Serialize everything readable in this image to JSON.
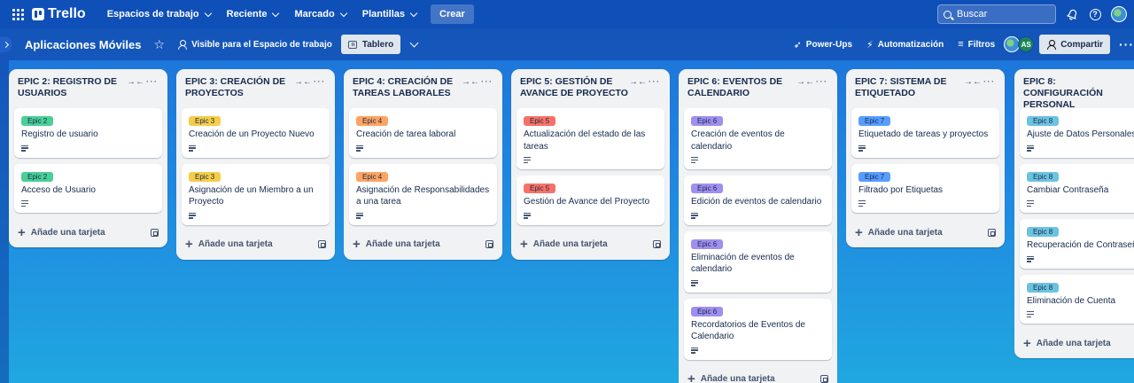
{
  "topnav": {
    "brand": "Trello",
    "items": [
      "Espacios de trabajo",
      "Reciente",
      "Marcado",
      "Plantillas"
    ],
    "create_label": "Crear",
    "search_placeholder": "Buscar"
  },
  "board": {
    "title": "Aplicaciones Móviles",
    "visibility": "Visible para el Espacio de trabajo",
    "view_label": "Tablero",
    "powerups": "Power-Ups",
    "automation": "Automatización",
    "filters": "Filtros",
    "avatar_initials": "AS",
    "share": "Compartir"
  },
  "add_card_label": "Añade una tarjeta",
  "label_colors": {
    "Epic 2": "#4bce97",
    "Epic 3": "#f5cd47",
    "Epic 4": "#fea362",
    "Epic 5": "#f87168",
    "Epic 6": "#9f8fef",
    "Epic 7": "#579dff",
    "Epic 8": "#6cc3e0"
  },
  "lists": [
    {
      "title": "EPIC 2: REGISTRO DE USUARIOS",
      "cards": [
        {
          "label": "Epic 2",
          "title": "Registro de usuario"
        },
        {
          "label": "Epic 2",
          "title": "Acceso de Usuario"
        }
      ]
    },
    {
      "title": "EPIC 3: CREACIÓN DE PROYECTOS",
      "cards": [
        {
          "label": "Epic 3",
          "title": "Creación de un Proyecto Nuevo"
        },
        {
          "label": "Epic 3",
          "title": "Asignación de un Miembro a un Proyecto"
        }
      ]
    },
    {
      "title": "EPIC 4: CREACIÓN DE TAREAS LABORALES",
      "cards": [
        {
          "label": "Epic 4",
          "title": "Creación de tarea laboral"
        },
        {
          "label": "Epic 4",
          "title": "Asignación de Responsabilidades a una tarea"
        }
      ]
    },
    {
      "title": "EPIC 5: GESTIÓN DE AVANCE DE PROYECTO",
      "cards": [
        {
          "label": "Epic 5",
          "title": "Actualización del estado de las tareas"
        },
        {
          "label": "Epic 5",
          "title": "Gestión de Avance del Proyecto"
        }
      ]
    },
    {
      "title": "EPIC 6: EVENTOS DE CALENDARIO",
      "cards": [
        {
          "label": "Epic 6",
          "title": "Creación de eventos de calendario"
        },
        {
          "label": "Epic 6",
          "title": "Edición de eventos de calendario"
        },
        {
          "label": "Epic 6",
          "title": "Eliminación de eventos de calendario"
        },
        {
          "label": "Epic 6",
          "title": "Recordatorios de Eventos de Calendario"
        }
      ]
    },
    {
      "title": "EPIC 7: SISTEMA DE ETIQUETADO",
      "cards": [
        {
          "label": "Epic 7",
          "title": "Etiquetado de tareas y proyectos"
        },
        {
          "label": "Epic 7",
          "title": "Filtrado por Etiquetas"
        }
      ]
    },
    {
      "title": "EPIC 8: CONFIGURACIÓN PERSONAL",
      "cards": [
        {
          "label": "Epic 8",
          "title": "Ajuste de Datos Personales"
        },
        {
          "label": "Epic 8",
          "title": "Cambiar Contraseña"
        },
        {
          "label": "Epic 8",
          "title": "Recuperación de Contraseña"
        },
        {
          "label": "Epic 8",
          "title": "Eliminación de Cuenta"
        }
      ]
    }
  ]
}
